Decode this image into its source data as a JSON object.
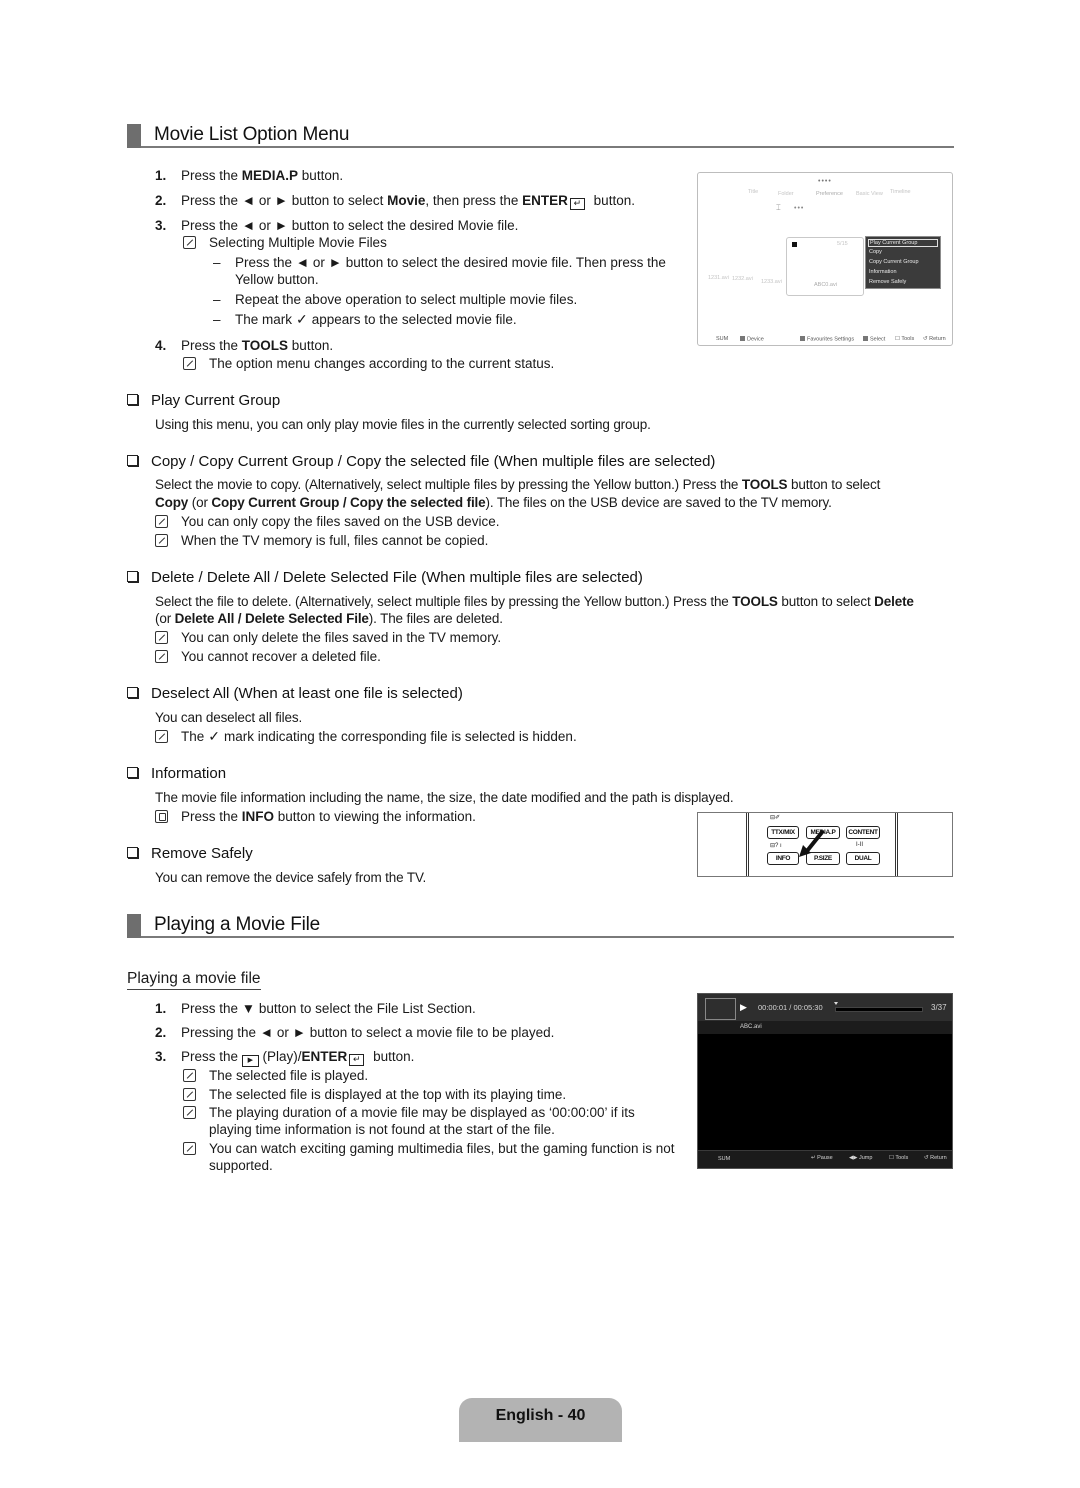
{
  "section1": {
    "title": "Movie List Option Menu",
    "steps": [
      {
        "num": "1.",
        "pre": "Press the ",
        "bold": "MEDIA.P",
        "post": " button."
      },
      {
        "num": "2.",
        "pre": "Press the ◄ or ► button to select ",
        "bold": "Movie",
        "mid": ", then press the ",
        "bold2": "ENTER",
        "post": " button."
      },
      {
        "num": "3.",
        "text": "Press the ◄ or ► button to select the desired Movie file."
      },
      {
        "num": "4.",
        "pre": "Press the ",
        "bold": "TOOLS",
        "post": " button."
      }
    ],
    "note_multi": "Selecting Multiple Movie Files",
    "dashes": [
      "Press the ◄ or ► button to select the desired movie file. Then press the",
      "Yellow button.",
      "Repeat the above operation to select multiple movie files.",
      "The mark",
      "appears to the selected movie file."
    ],
    "note_tools": "The option menu changes according to the current status."
  },
  "tv_screen_1": {
    "stars_top": "••••",
    "tabs": [
      "Title",
      "Folder",
      "Preference",
      "Basic View",
      "Timeline"
    ],
    "stars_mid": "•••",
    "files": [
      "1231.avi",
      "1232.avi",
      "1233.avi"
    ],
    "card_counter": "5/15",
    "card_name": "ABC0.avi",
    "menu_items": [
      "Play Current Group",
      "Copy",
      "Copy Current Group",
      "Information",
      "Remove Safely"
    ],
    "bottom": {
      "sum": "SUM",
      "device": "Device",
      "fav": "Favourites Settings",
      "select": "Select",
      "tools": "Tools",
      "return": "Return"
    }
  },
  "options": [
    {
      "heading": "Play Current Group",
      "body": "Using this menu, you can only play movie files in the currently selected sorting group."
    },
    {
      "heading": "Copy / Copy Current Group / Copy the selected file (When multiple files are selected)",
      "body1_pre": "Select the movie to copy. (Alternatively, select multiple files by pressing the Yellow button.) Press the ",
      "body1_bold": "TOOLS",
      "body1_post": " button to select",
      "body2_b1": "Copy",
      "body2_m1": " (or ",
      "body2_b2": "Copy Current Group / Copy the selected file",
      "body2_post": "). The files on the USB device are saved to the TV memory.",
      "notes": [
        "You can only copy the files saved on the USB device.",
        "When the TV memory is full, files cannot be copied."
      ]
    },
    {
      "heading": "Delete / Delete All / Delete Selected File (When multiple files are selected)",
      "body1_pre": "Select the file to delete. (Alternatively, select multiple files by pressing the Yellow button.) Press the ",
      "body1_bold": "TOOLS",
      "body1_mid": " button to select ",
      "body1_bold2": "Delete",
      "body2_pre": "(or ",
      "body2_bold": "Delete All / Delete Selected File",
      "body2_post": "). The files are deleted.",
      "notes": [
        "You can only delete the files saved in the TV memory.",
        "You cannot recover a deleted file."
      ]
    },
    {
      "heading": "Deselect All (When at least one file is selected)",
      "body": "You can deselect all files.",
      "note_pre": "The",
      "note_post": "mark indicating the corresponding file is selected is hidden."
    },
    {
      "heading": "Information",
      "body": "The movie file information including the name, the size, the date modified and the path is displayed.",
      "note_pre": "Press the ",
      "note_bold": "INFO",
      "note_post": " button to viewing the information."
    },
    {
      "heading": "Remove Safely",
      "body": "You can remove the device safely from the TV."
    }
  ],
  "remote": {
    "top_labels": [
      "TTX/MIX",
      "MEDIA.P",
      "CONTENT"
    ],
    "bottom_labels": [
      "INFO",
      "P.SIZE",
      "DUAL"
    ],
    "small_1": "⊟✐",
    "small_2": "⊟? ı",
    "small_3": "I-II"
  },
  "section2": {
    "title": "Playing a Movie File",
    "subtitle": "Playing a movie file",
    "steps": [
      {
        "num": "1.",
        "text": "Press the ▼ button to select the File List Section."
      },
      {
        "num": "2.",
        "text": "Pressing the ◄ or ► button to select a movie file to be played."
      },
      {
        "num": "3.",
        "pre": "Press the ",
        "mid": " (Play)/",
        "bold": "ENTER",
        "post": " button."
      }
    ],
    "notes": [
      "The selected file is played.",
      "The selected file is displayed at the top with its playing time.",
      "The playing duration of a movie file may be displayed as ‘00:00:00’ if its",
      "playing time information is not found at the start of the file.",
      "You can watch exciting gaming multimedia files, but the gaming function is not",
      "supported."
    ]
  },
  "tv_screen_2": {
    "play_icon": "▶",
    "time": "00:00:01 / 00:05:30",
    "progress_fraction": 0.003,
    "counter": "3/37",
    "file_name": "ABC.avi",
    "bottom": {
      "sum": "SUM",
      "pause": "Pause",
      "jump": "Jump",
      "tools": "Tools",
      "return": "Return"
    }
  },
  "footer": {
    "page_label": "English - 40"
  }
}
